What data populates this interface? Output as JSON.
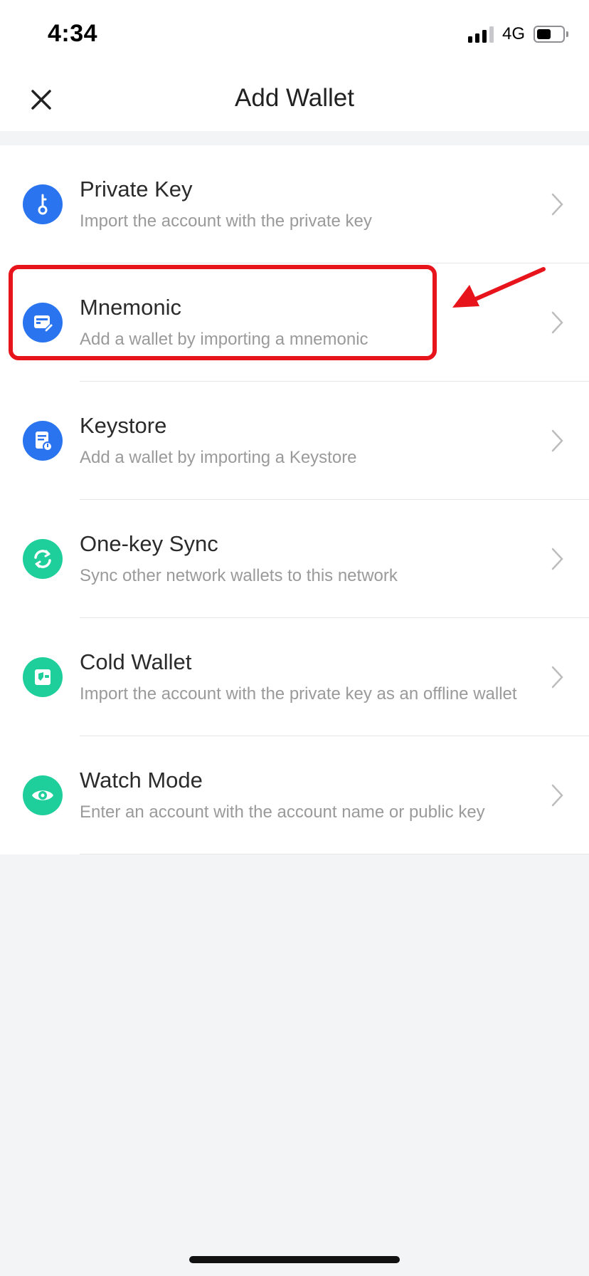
{
  "status_bar": {
    "time": "4:34",
    "network": "4G"
  },
  "header": {
    "title": "Add Wallet"
  },
  "options": [
    {
      "title": "Private Key",
      "subtitle": "Import the account with the private key",
      "icon": "key-icon",
      "color": "#2a74f0"
    },
    {
      "title": "Mnemonic",
      "subtitle": "Add a wallet by importing a mnemonic",
      "icon": "mnemonic-icon",
      "color": "#2a74f0"
    },
    {
      "title": "Keystore",
      "subtitle": "Add a wallet by importing a Keystore",
      "icon": "keystore-icon",
      "color": "#2a74f0"
    },
    {
      "title": "One-key Sync",
      "subtitle": "Sync other network wallets to this network",
      "icon": "sync-icon",
      "color": "#1fcf9b"
    },
    {
      "title": "Cold Wallet",
      "subtitle": "Import the account with the private key as an offline wallet",
      "icon": "cold-wallet-icon",
      "color": "#1fcf9b"
    },
    {
      "title": "Watch Mode",
      "subtitle": "Enter an account with the account name or public key",
      "icon": "eye-icon",
      "color": "#1fcf9b"
    }
  ],
  "annotation": {
    "highlight_color": "#e8141c"
  }
}
